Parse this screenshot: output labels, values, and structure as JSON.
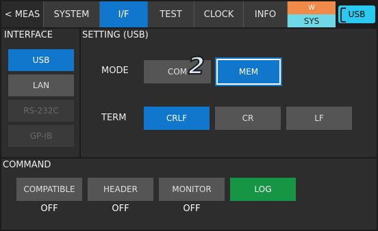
{
  "tabs": {
    "meas": "< MEAS",
    "system": "SYSTEM",
    "if": "I/F",
    "test": "TEST",
    "clock": "CLOCK",
    "info": "INFO"
  },
  "sys_indicator": {
    "top": "W",
    "bottom": "SYS"
  },
  "usb_badge": "USB",
  "interface": {
    "title": "INTERFACE",
    "items": [
      "USB",
      "LAN",
      "RS-232C",
      "GP-IB"
    ]
  },
  "setting": {
    "title": "SETTING (USB)",
    "mode_label": "MODE",
    "mode_options": [
      "COM",
      "MEM"
    ],
    "term_label": "TERM",
    "term_options": [
      "CRLF",
      "CR",
      "LF"
    ],
    "step_marker": "2"
  },
  "command": {
    "title": "COMMAND",
    "buttons": [
      "COMPATIBLE",
      "HEADER",
      "MONITOR",
      "LOG"
    ],
    "states": [
      "OFF",
      "OFF",
      "OFF"
    ]
  },
  "colors": {
    "accent": "#1177cc",
    "log_green": "#169544",
    "sys_orange": "#f08a48",
    "sys_cyan": "#6fd8e6",
    "usb_cyan": "#29c9f0"
  }
}
